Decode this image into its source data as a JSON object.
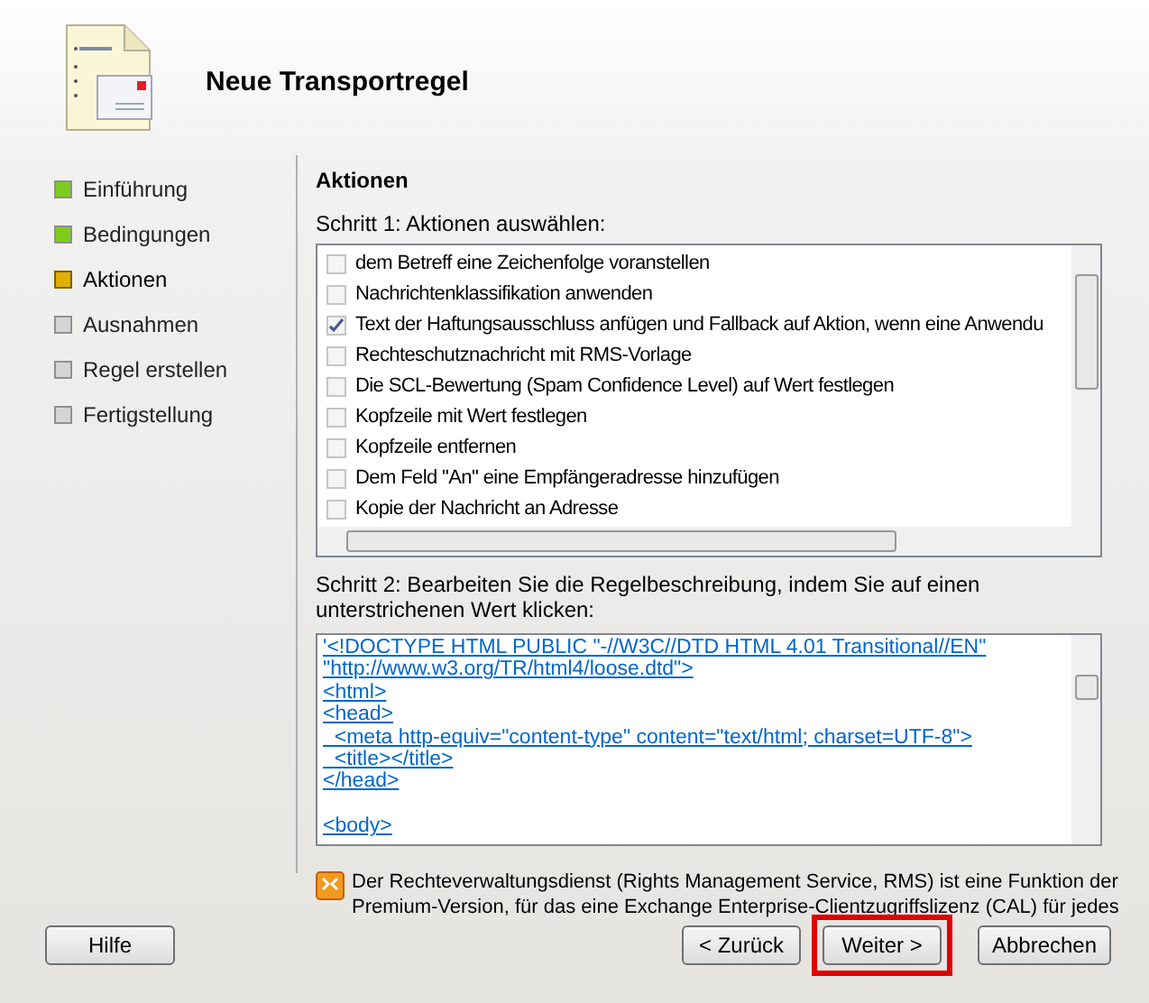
{
  "header": {
    "title": "Neue Transportregel"
  },
  "steps": [
    {
      "label": "Einführung",
      "color": "#7ccc1c",
      "selected": false
    },
    {
      "label": "Bedingungen",
      "color": "#7ccc1c",
      "selected": false
    },
    {
      "label": "Aktionen",
      "color": "#e0b000",
      "selected": true
    },
    {
      "label": "Ausnahmen",
      "color": "#d4d4d4",
      "selected": false
    },
    {
      "label": "Regel erstellen",
      "color": "#d4d4d4",
      "selected": false
    },
    {
      "label": "Fertigstellung",
      "color": "#d4d4d4",
      "selected": false
    }
  ],
  "section_title": "Aktionen",
  "step1": {
    "label": "Schritt 1: Aktionen auswählen:",
    "actions": [
      {
        "label": "dem Betreff eine Zeichenfolge voranstellen",
        "checked": false
      },
      {
        "label": "Nachrichtenklassifikation  anwenden",
        "checked": false
      },
      {
        "label": "Text der Haftungsausschluss anfügen und Fallback auf Aktion, wenn eine Anwendu",
        "checked": true
      },
      {
        "label": "Rechteschutznachricht mit RMS-Vorlage",
        "checked": false
      },
      {
        "label": "Die SCL-Bewertung (Spam Confidence Level) auf Wert festlegen",
        "checked": false
      },
      {
        "label": "Kopfzeile mit Wert festlegen",
        "checked": false
      },
      {
        "label": "Kopfzeile entfernen",
        "checked": false
      },
      {
        "label": "Dem Feld \"An\" eine Empfängeradresse hinzufügen",
        "checked": false
      },
      {
        "label": "Kopie der Nachricht an Adresse",
        "checked": false
      }
    ]
  },
  "step2": {
    "label": "Schritt 2: Bearbeiten Sie die Regelbeschreibung, indem Sie auf einen unterstrichenen Wert klicken:",
    "blocks": [
      [
        "'<!DOCTYPE HTML PUBLIC \"-//W3C//DTD HTML 4.01 Transitional//EN\"",
        "\"http://www.w3.org/TR/html4/loose.dtd\">",
        "<html>",
        "<head>",
        "  <meta http-equiv=\"content-type\" content=\"text/html; charset=UTF-8\">",
        "  <title></title>",
        "</head>"
      ],
      [
        "<body>"
      ]
    ]
  },
  "notice": "Der Rechteverwaltungsdienst (Rights Management Service, RMS) ist eine Funktion der Premium-Version, für das eine Exchange Enterprise-Clientzugriffslizenz (CAL) für jedes",
  "buttons": [
    {
      "label": "Hilfe",
      "highlighted": false
    },
    {
      "label": "< Zurück",
      "highlighted": false
    },
    {
      "label": "Weiter >",
      "highlighted": true
    },
    {
      "label": "Abbrechen",
      "highlighted": false
    }
  ]
}
